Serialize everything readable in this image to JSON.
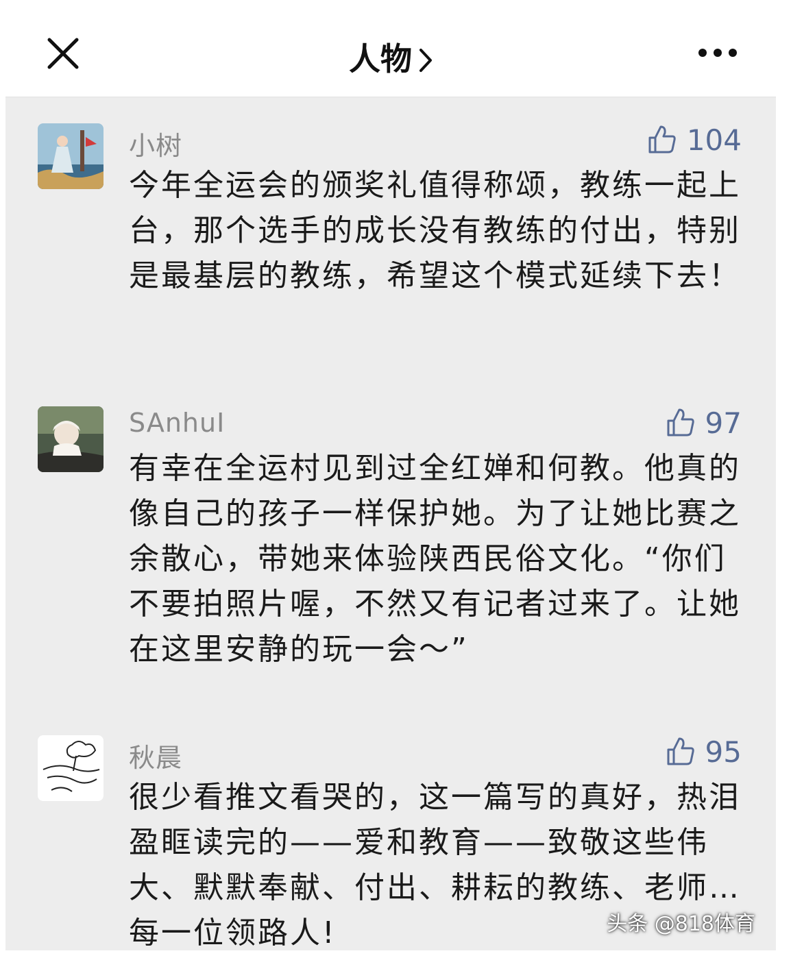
{
  "header": {
    "title": "人物",
    "close_icon": "close-icon",
    "more_icon": "more-icon",
    "chevron_icon": "chevron-right-icon"
  },
  "comments": [
    {
      "nickname": "小树",
      "likes": "104",
      "text": "今年全运会的颁奖礼值得称颂，教练一起上台，那个选手的成长没有教练的付出，特别是最基层的教练，希望这个模式延续下去！"
    },
    {
      "nickname": "SAnhuI",
      "likes": "97",
      "text": "有幸在全运村见到过全红婵和何教。他真的像自己的孩子一样保护她。为了让她比赛之余散心，带她来体验陕西民俗文化。“你们不要拍照片喔，不然又有记者过来了。让她在这里安静的玩一会～”"
    },
    {
      "nickname": "秋晨",
      "likes": "95",
      "text": "很少看推文看哭的，这一篇写的真好，热泪盈眶读完的——爱和教育——致敬这些伟大、默默奉献、付出、耕耘的教练、老师…每一位领路人!"
    }
  ],
  "watermark": "头条 @818体育",
  "colors": {
    "background": "#ededed",
    "like_accent": "#576b95",
    "nickname": "#8a8a8a",
    "text": "#1a1a1a"
  }
}
